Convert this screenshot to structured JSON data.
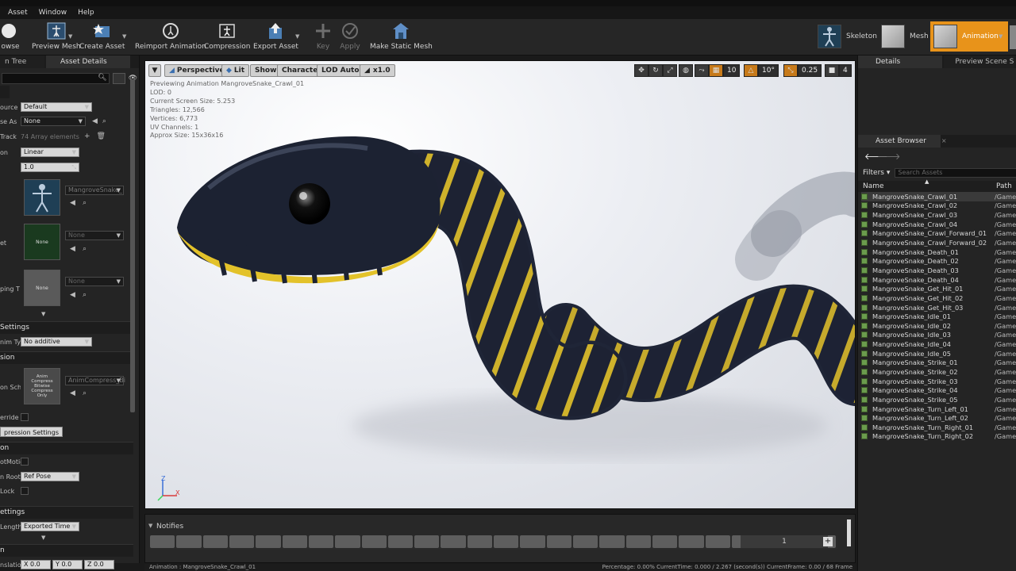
{
  "menu": [
    "Asset",
    "Window",
    "Help"
  ],
  "toolbar": {
    "browse": "owse",
    "preview_mesh": "Preview Mesh",
    "create_asset": "Create Asset",
    "reimport_animation": "Reimport Animation",
    "compression": "Compression",
    "export_asset": "Export Asset",
    "key": "Key",
    "apply": "Apply",
    "make_static_mesh": "Make Static Mesh"
  },
  "modes": {
    "skeleton": "Skeleton",
    "mesh": "Mesh",
    "animation": "Animation",
    "active": "animation",
    "active_color": "#e8931a"
  },
  "left_panel": {
    "tabs": [
      "n Tree",
      "Asset Details"
    ],
    "props": {
      "source_label": "ource",
      "source_value": "Default",
      "use_as_label": "se As",
      "use_as_value": "None",
      "track_label": "Track",
      "track_value": "74 Array elements",
      "interp_label": "on",
      "interp_value": "Linear",
      "rate_value": "1.0",
      "skeleton_value": "MangroveSnake_",
      "none_thumb_1": "None",
      "none_value_1": "None",
      "set_label": "et",
      "ping_label": "ping T",
      "none_thumb_2": "None",
      "none_value_2": "None",
      "settings_header": "Settings",
      "anim_type_label": "nim Ty",
      "anim_type_value": "No additive",
      "compression_header": "sion",
      "compression_scheme_label": "on Sch",
      "compress_thumb": "Anim Compress Bitwise Compress Only",
      "compress_value": "AnimCompress_Bi",
      "override_label": "erride t",
      "compression_settings_btn": "pression Settings",
      "root_header": "on",
      "root_motion_label": "otMotio",
      "root_lock_label": "n Root",
      "root_lock_value": "Ref Pose",
      "lock_label": "Lock",
      "import_header": "ettings",
      "length_label": "Length",
      "length_value": "Exported Time",
      "transform_header": "n",
      "tr_label": "nslatio",
      "x_label": "X",
      "x_value": "0.0",
      "y_label": "Y",
      "y_value": "0.0",
      "z_label": "Z",
      "z_value": "0.0"
    }
  },
  "viewport": {
    "perspective": "Perspective",
    "lit": "Lit",
    "show": "Show",
    "character": "Character",
    "lod": "LOD Auto",
    "speed": "x1.0",
    "grid_size": "10",
    "rot_size": "10°",
    "scale_size": "0.25",
    "cam_speed": "4",
    "stats": [
      "Previewing Animation MangroveSnake_Crawl_01",
      "LOD: 0",
      "Current Screen Size: 5.253",
      "Triangles: 12,566",
      "Vertices: 6,773",
      "UV Channels: 1",
      "Approx Size: 15x36x16"
    ],
    "axis_x": "X",
    "axis_z": "Z"
  },
  "timeline": {
    "notifies": "Notifies",
    "track_value": "1",
    "plus": "+"
  },
  "status": {
    "left": "Animation : MangroveSnake_Crawl_01",
    "right": "Percentage: 0.00%  CurrentTime: 0.000 / 2.267 (second(s))  CurrentFrame: 0.00 / 68 Frame"
  },
  "right_panel": {
    "tabs": [
      "Details",
      "Preview Scene Se"
    ],
    "asset_browser_tab": "Asset Browser",
    "filters": "Filters",
    "search_placeholder": "Search Assets",
    "col_name": "Name",
    "col_path": "Path",
    "selected_index": 0,
    "assets": [
      {
        "name": "MangroveSnake_Crawl_01",
        "path": "/Game"
      },
      {
        "name": "MangroveSnake_Crawl_02",
        "path": "/Game"
      },
      {
        "name": "MangroveSnake_Crawl_03",
        "path": "/Game"
      },
      {
        "name": "MangroveSnake_Crawl_04",
        "path": "/Game"
      },
      {
        "name": "MangroveSnake_Crawl_Forward_01",
        "path": "/Game"
      },
      {
        "name": "MangroveSnake_Crawl_Forward_02",
        "path": "/Game"
      },
      {
        "name": "MangroveSnake_Death_01",
        "path": "/Game"
      },
      {
        "name": "MangroveSnake_Death_02",
        "path": "/Game"
      },
      {
        "name": "MangroveSnake_Death_03",
        "path": "/Game"
      },
      {
        "name": "MangroveSnake_Death_04",
        "path": "/Game"
      },
      {
        "name": "MangroveSnake_Get_Hit_01",
        "path": "/Game"
      },
      {
        "name": "MangroveSnake_Get_Hit_02",
        "path": "/Game"
      },
      {
        "name": "MangroveSnake_Get_Hit_03",
        "path": "/Game"
      },
      {
        "name": "MangroveSnake_Idle_01",
        "path": "/Game"
      },
      {
        "name": "MangroveSnake_Idle_02",
        "path": "/Game"
      },
      {
        "name": "MangroveSnake_Idle_03",
        "path": "/Game"
      },
      {
        "name": "MangroveSnake_Idle_04",
        "path": "/Game"
      },
      {
        "name": "MangroveSnake_Idle_05",
        "path": "/Game"
      },
      {
        "name": "MangroveSnake_Strike_01",
        "path": "/Game"
      },
      {
        "name": "MangroveSnake_Strike_02",
        "path": "/Game"
      },
      {
        "name": "MangroveSnake_Strike_03",
        "path": "/Game"
      },
      {
        "name": "MangroveSnake_Strike_04",
        "path": "/Game"
      },
      {
        "name": "MangroveSnake_Strike_05",
        "path": "/Game"
      },
      {
        "name": "MangroveSnake_Turn_Left_01",
        "path": "/Game"
      },
      {
        "name": "MangroveSnake_Turn_Left_02",
        "path": "/Game"
      },
      {
        "name": "MangroveSnake_Turn_Right_01",
        "path": "/Game"
      },
      {
        "name": "MangroveSnake_Turn_Right_02",
        "path": "/Game"
      }
    ]
  }
}
